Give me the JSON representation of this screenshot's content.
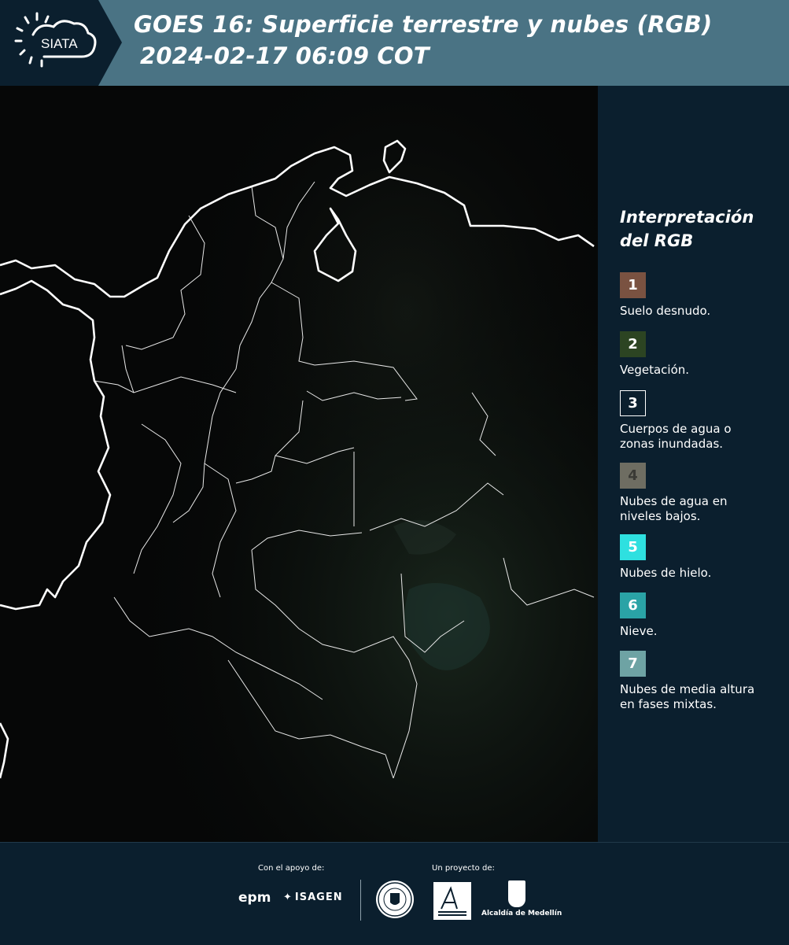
{
  "header": {
    "logo_text": "SIATA",
    "title_line1": "GOES 16: Superficie terrestre y nubes (RGB)",
    "title_line2": "2024-02-17 06:09 COT"
  },
  "legend": {
    "title_line1": "Interpretación",
    "title_line2": "del RGB",
    "items": [
      {
        "num": "1",
        "color": "#7a5241",
        "text": [
          "Suelo desnudo."
        ]
      },
      {
        "num": "2",
        "color": "#2c4422",
        "text": [
          "Vegetación."
        ]
      },
      {
        "num": "3",
        "color": "#0b1f2e",
        "text": [
          "Cuerpos de agua o",
          "zonas inundadas."
        ]
      },
      {
        "num": "4",
        "color": "#6e6d62",
        "text": [
          "Nubes de agua en",
          "niveles bajos."
        ]
      },
      {
        "num": "5",
        "color": "#2ee0e0",
        "text": [
          "Nubes de hielo."
        ]
      },
      {
        "num": "6",
        "color": "#2aa3a6",
        "text": [
          "Nieve."
        ]
      },
      {
        "num": "7",
        "color": "#6ea3a4",
        "text": [
          "Nubes de media altura",
          "en fases mixtas."
        ]
      }
    ]
  },
  "footer": {
    "support_label": "Con el apoyo de:",
    "project_label": "Un proyecto de:",
    "epm": "epm",
    "isagen": "ISAGEN",
    "alcaldia": "Alcaldía de Medellín"
  }
}
